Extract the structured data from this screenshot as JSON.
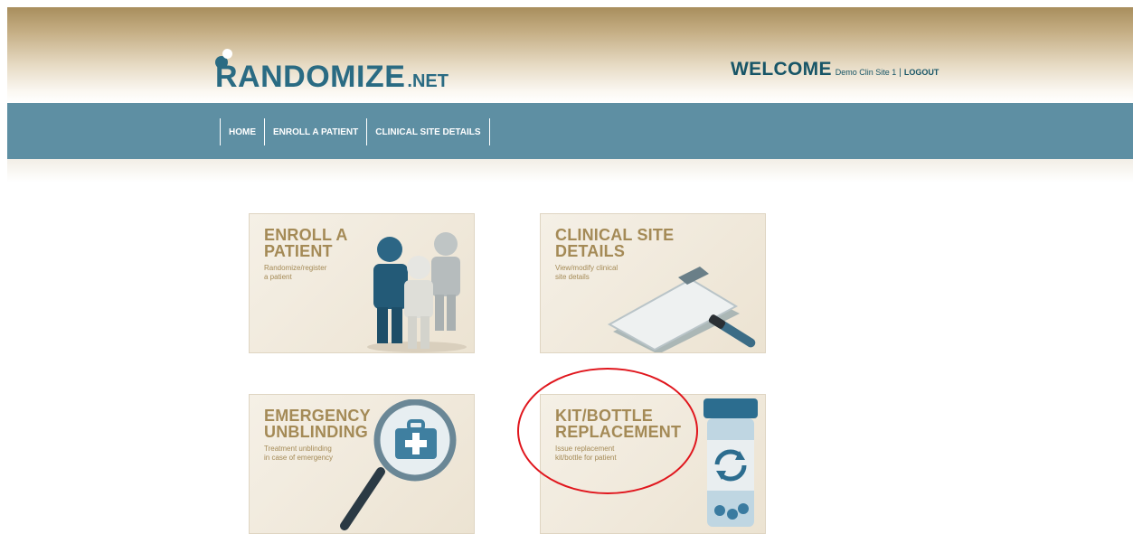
{
  "header": {
    "logo_main": "RANDOMIZE",
    "logo_suffix": ".NET",
    "welcome": "WELCOME",
    "site_name": "Demo Clin Site 1",
    "separator": "|",
    "logout": "LOGOUT"
  },
  "nav": {
    "items": [
      {
        "label": "HOME"
      },
      {
        "label": "ENROLL A PATIENT"
      },
      {
        "label": "CLINICAL SITE DETAILS"
      }
    ]
  },
  "tiles": [
    {
      "title": "ENROLL A\nPATIENT",
      "description": "Randomize/register\na patient",
      "icon": "people-icon"
    },
    {
      "title": "CLINICAL SITE\nDETAILS",
      "description": "View/modify clinical\nsite details",
      "icon": "clipboard-icon"
    },
    {
      "title": "EMERGENCY\nUNBLINDING",
      "description": "Treatment unblinding\nin case of emergency",
      "icon": "magnifier-medkit-icon"
    },
    {
      "title": "KIT/BOTTLE\nREPLACEMENT",
      "description": "Issue replacement\nkit/bottle for patient",
      "icon": "pill-bottle-refresh-icon"
    }
  ],
  "colors": {
    "brand_teal": "#2a6b83",
    "nav_bar": "#5e8fa3",
    "tile_text": "#a48a56",
    "annotation": "#e0161d"
  }
}
